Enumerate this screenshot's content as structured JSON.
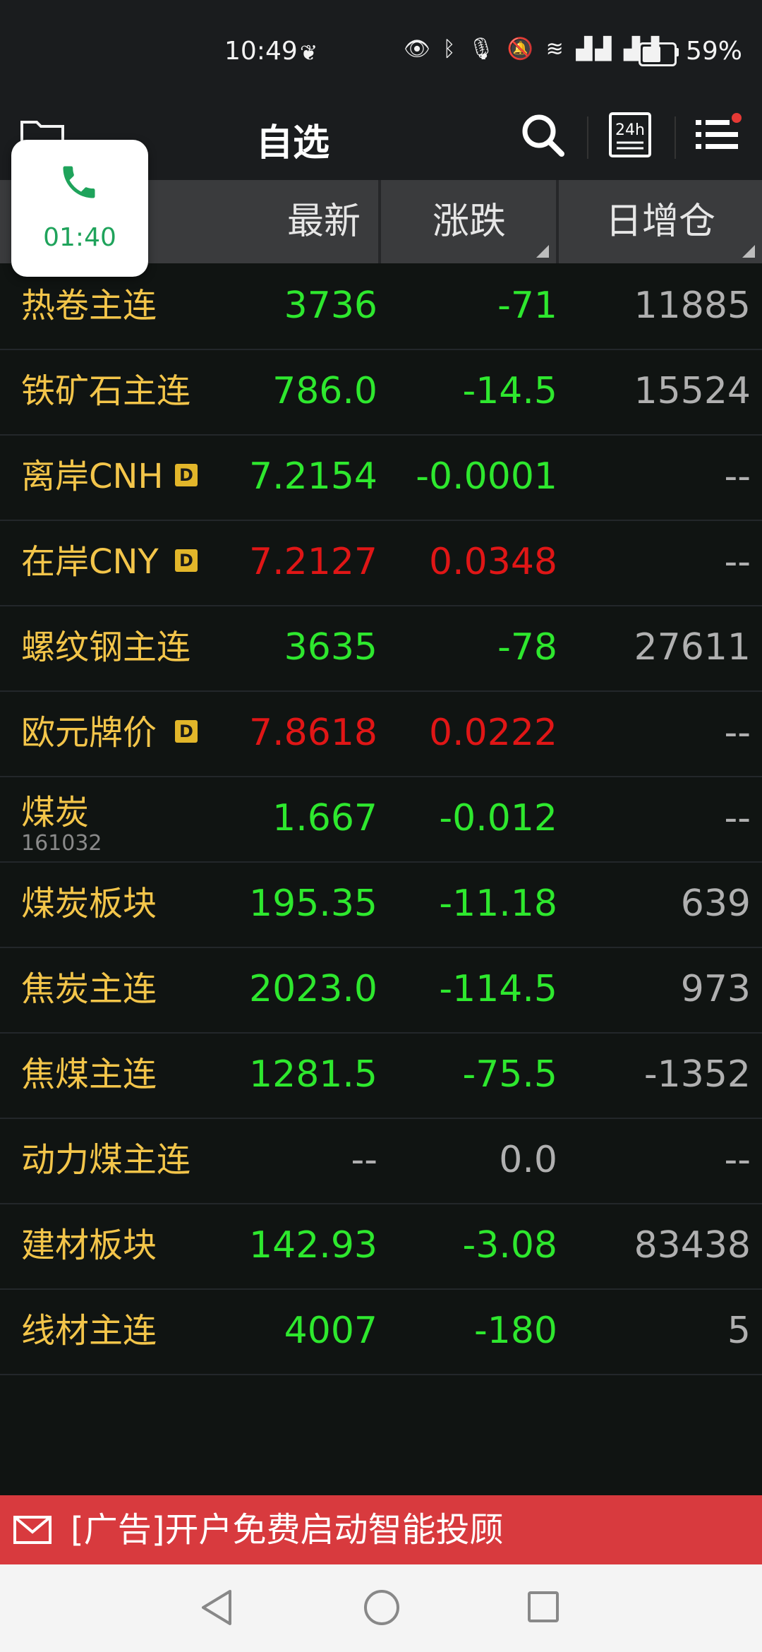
{
  "status_bar": {
    "time": "10:49",
    "battery_percent": "59%",
    "battery_level": 0.59,
    "icons": [
      "eye-icon",
      "bluetooth-icon",
      "mic-icon",
      "mute-icon",
      "wifi-icon",
      "5g-signal-icon",
      "4g-signal-icon",
      "battery-icon"
    ]
  },
  "header": {
    "title": "自选",
    "icons": [
      "folder-icon",
      "search-icon",
      "24h-icon",
      "menu-list-icon"
    ]
  },
  "call_bubble": {
    "duration": "01:40"
  },
  "columns": {
    "latest": "最新",
    "change": "涨跌",
    "open_interest": "日增仓"
  },
  "rows": [
    {
      "name": "热卷主连",
      "latest": "3736",
      "change": "-71",
      "oi": "11885",
      "color": "green"
    },
    {
      "name": "铁矿石主连",
      "latest": "786.0",
      "change": "-14.5",
      "oi": "15524",
      "color": "green"
    },
    {
      "name": "离岸CNH",
      "badge": "D",
      "latest": "7.2154",
      "change": "-0.0001",
      "oi": "--",
      "color": "green"
    },
    {
      "name": "在岸CNY",
      "badge": "D",
      "latest": "7.2127",
      "change": "0.0348",
      "oi": "--",
      "color": "red"
    },
    {
      "name": "螺纹钢主连",
      "latest": "3635",
      "change": "-78",
      "oi": "27611",
      "color": "green"
    },
    {
      "name": "欧元牌价",
      "badge": "D",
      "latest": "7.8618",
      "change": "0.0222",
      "oi": "--",
      "color": "red"
    },
    {
      "name": "煤炭",
      "code": "161032",
      "latest": "1.667",
      "change": "-0.012",
      "oi": "--",
      "color": "green"
    },
    {
      "name": "煤炭板块",
      "latest": "195.35",
      "change": "-11.18",
      "oi": "639",
      "color": "green"
    },
    {
      "name": "焦炭主连",
      "latest": "2023.0",
      "change": "-114.5",
      "oi": "973",
      "color": "green"
    },
    {
      "name": "焦煤主连",
      "latest": "1281.5",
      "change": "-75.5",
      "oi": "-1352",
      "color": "green"
    },
    {
      "name": "动力煤主连",
      "latest": "--",
      "change": "0.0",
      "oi": "--",
      "color": "gray"
    },
    {
      "name": "建材板块",
      "latest": "142.93",
      "change": "-3.08",
      "oi": "83438",
      "color": "green"
    },
    {
      "name": "线材主连",
      "latest": "4007",
      "change": "-180",
      "oi": "5",
      "color": "green"
    }
  ],
  "ad": {
    "text": "[广告]开户免费启动智能投顾"
  },
  "colors": {
    "up": "#e01616",
    "down": "#2ee82e",
    "name": "#f3c54a",
    "ad_bg": "#d83a3e"
  }
}
